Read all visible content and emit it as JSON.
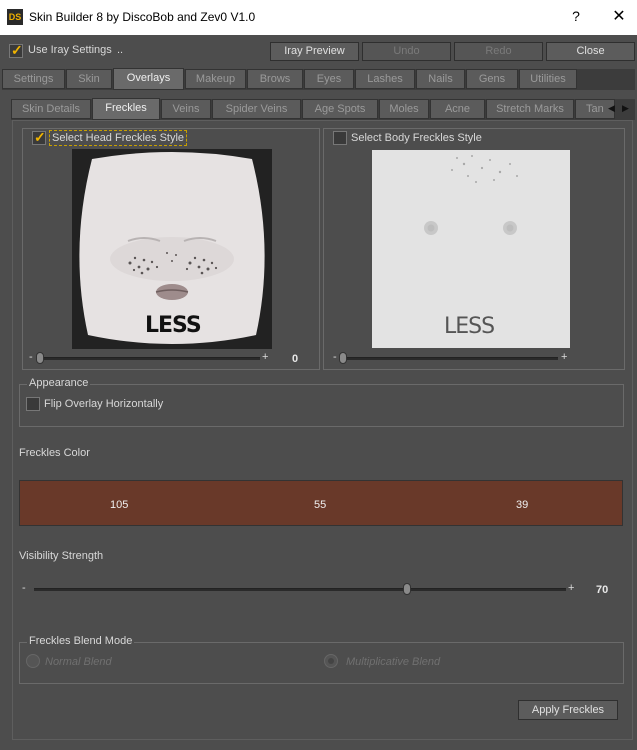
{
  "window": {
    "title": "Skin Builder 8 by DiscoBob and Zev0 V1.0",
    "icon_text": "DS",
    "help": "?",
    "close": "✕"
  },
  "toolbar": {
    "use_iray": "Use Iray Settings",
    "dots": "..",
    "iray_preview": "Iray Preview",
    "undo": "Undo",
    "redo": "Redo",
    "close": "Close"
  },
  "main_tabs": [
    "Settings",
    "Skin",
    "Overlays",
    "Makeup",
    "Brows",
    "Eyes",
    "Lashes",
    "Nails",
    "Gens",
    "Utilities"
  ],
  "sub_tabs": [
    "Skin Details",
    "Freckles",
    "Veins",
    "Spider Veins",
    "Age Spots",
    "Moles",
    "Acne",
    "Stretch Marks",
    "Tan"
  ],
  "head": {
    "label": "Select Head Freckles Style",
    "preview_text": "LESS",
    "slider_min": "-",
    "slider_max": "+",
    "value": "0"
  },
  "body": {
    "label": "Select Body Freckles Style",
    "preview_text": "LESS",
    "slider_min": "-",
    "slider_max": "+"
  },
  "appearance": {
    "title": "Appearance",
    "flip": "Flip Overlay Horizontally"
  },
  "freckles_color": {
    "title": "Freckles Color",
    "r": "105",
    "g": "55",
    "b": "39",
    "hex": "#693927"
  },
  "visibility": {
    "title": "Visibility Strength",
    "min": "-",
    "max": "+",
    "value": "70"
  },
  "blend": {
    "title": "Freckles Blend Mode",
    "normal": "Normal Blend",
    "multiplicative": "Multiplicative Blend"
  },
  "apply": "Apply Freckles",
  "scroll_left": "◀",
  "scroll_right": "▶"
}
